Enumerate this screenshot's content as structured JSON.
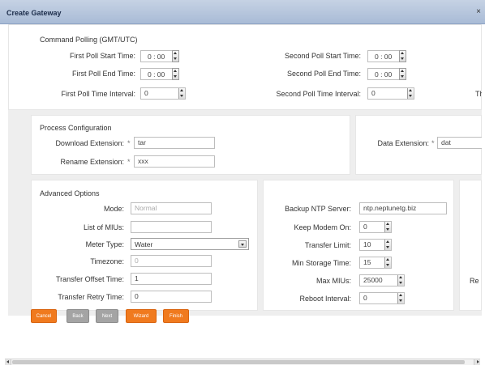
{
  "window": {
    "title": "Create Gateway",
    "close_glyph": "×"
  },
  "command_polling": {
    "title": "Command Polling (GMT/UTC)",
    "first_start": {
      "label": "First Poll Start Time:",
      "value": "0 : 00"
    },
    "first_end": {
      "label": "First Poll End Time:",
      "value": "0 : 00"
    },
    "first_interval": {
      "label": "First Poll Time Interval:",
      "value": "0"
    },
    "second_start": {
      "label": "Second Poll Start Time:",
      "value": "0 : 00"
    },
    "second_end": {
      "label": "Second Poll End Time:",
      "value": "0 : 00"
    },
    "second_interval": {
      "label": "Second Poll Time Interval:",
      "value": "0"
    },
    "third_interval_label_partial": "Th"
  },
  "process_config": {
    "title": "Process Configuration",
    "download_ext": {
      "label": "Download Extension:",
      "value": "tar"
    },
    "rename_ext": {
      "label": "Rename Extension:",
      "value": "xxx"
    },
    "data_ext": {
      "label": "Data Extension:",
      "value": "dat"
    },
    "required_mark": "*"
  },
  "advanced": {
    "title": "Advanced Options",
    "mode": {
      "label": "Mode:",
      "value": "Normal"
    },
    "list_of_mius": {
      "label": "List of MIUs:",
      "value": ""
    },
    "meter_type": {
      "label": "Meter Type:",
      "value": "Water"
    },
    "timezone": {
      "label": "Timezone:",
      "value": "0"
    },
    "transfer_offset": {
      "label": "Transfer Offset Time:",
      "value": "1"
    },
    "transfer_retry": {
      "label": "Transfer Retry Time:",
      "value": "0"
    },
    "backup_ntp": {
      "label": "Backup NTP Server:",
      "value": "ntp.neptunetg.biz"
    },
    "keep_modem_on": {
      "label": "Keep Modem On:",
      "value": "0"
    },
    "transfer_limit": {
      "label": "Transfer Limit:",
      "value": "10"
    },
    "min_storage": {
      "label": "Min Storage Time:",
      "value": "15"
    },
    "max_mius": {
      "label": "Max MIUs:",
      "value": "25000"
    },
    "reboot_interval": {
      "label": "Reboot Interval:",
      "value": "0"
    },
    "partial_right_label": "Re"
  },
  "buttons": {
    "cancel": "Cancel",
    "back": "Back",
    "next": "Next",
    "wizard": "Wizard",
    "finish": "Finish"
  },
  "colors": {
    "accent_orange": "#f07a1e",
    "disabled_gray": "#a4a4a4",
    "titlebar": "#b6c6de"
  }
}
